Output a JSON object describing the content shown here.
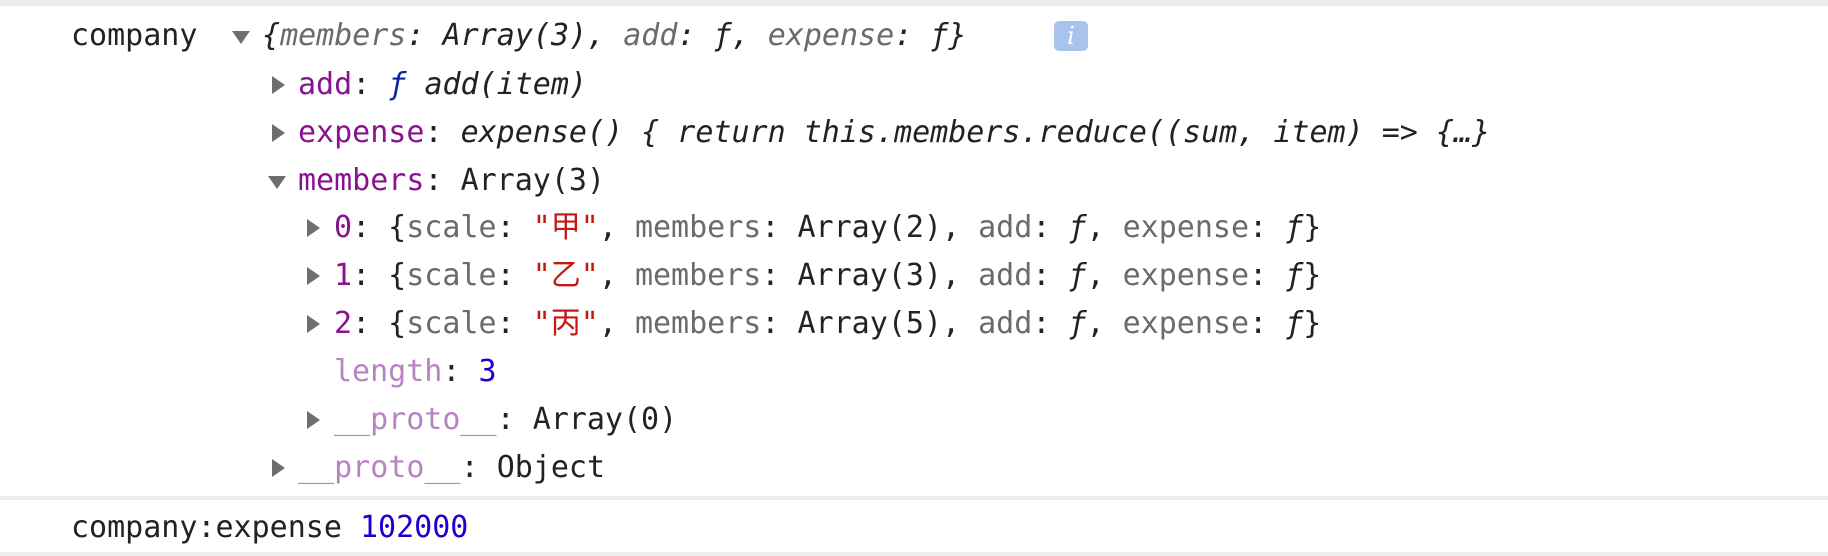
{
  "console": {
    "object_label": "company",
    "object_summary": {
      "open": "{",
      "k1": "members",
      "v1": "Array(3)",
      "k2": "add",
      "v2": "ƒ",
      "k3": "expense",
      "v3": "ƒ",
      "close": "}"
    },
    "info_icon": "i",
    "add_row": {
      "key": "add",
      "fn_prefix": "ƒ",
      "value": "add(item)"
    },
    "expense_row": {
      "key": "expense",
      "value": "expense() { return this.members.reduce((sum, item) => {…}"
    },
    "members_row": {
      "key": "members",
      "value": "Array(3)"
    },
    "items": [
      {
        "index": "0",
        "scale": "\"甲\"",
        "members": "Array(2)"
      },
      {
        "index": "1",
        "scale": "\"乙\"",
        "members": "Array(3)"
      },
      {
        "index": "2",
        "scale": "\"丙\"",
        "members": "Array(5)"
      }
    ],
    "item_keys": {
      "scale": "scale",
      "members": "members",
      "add": "add",
      "expense": "expense",
      "f": "ƒ"
    },
    "length_row": {
      "key": "length",
      "value": "3"
    },
    "array_proto_row": {
      "key": "__proto__",
      "value": "Array(0)"
    },
    "object_proto_row": {
      "key": "__proto__",
      "value": "Object"
    },
    "log_line": {
      "label": "company:expense",
      "value": "102000"
    }
  },
  "colors": {
    "property": "#881391",
    "string": "#c41a16",
    "number": "#1c00cf",
    "info_badge": "#a9c4ec"
  },
  "icons": [
    "triangle-down-icon",
    "triangle-right-icon",
    "info-icon"
  ]
}
